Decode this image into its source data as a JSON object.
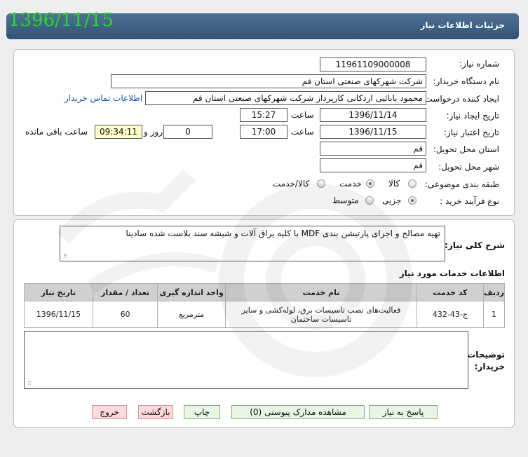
{
  "header": {
    "date_stamp": "1396/11/15",
    "title": "جزئیات اطلاعات نیاز"
  },
  "form": {
    "need_number": {
      "label": "شماره نیاز:",
      "value": "11961109000008"
    },
    "buyer_org": {
      "label": "نام دستگاه خریدار:",
      "value": "شرکت شهرکهای صنعتی استان قم"
    },
    "requester": {
      "label": "ایجاد کننده درخواست:",
      "value": "محمود بابائیی اردکانی کارپرداز شرکت شهرکهای صنعتی استان قم",
      "contact_link": "اطلاعات تماس خریدار"
    },
    "created": {
      "label": "تاریخ ایجاد نیاز:",
      "date": "1396/11/14",
      "time_label": "ساعت",
      "time": "15:27"
    },
    "validity": {
      "label": "تاریخ اعتبار نیاز:",
      "date": "1396/11/15",
      "time_label": "ساعت",
      "time": "17:00",
      "days": "0",
      "days_label": "روز و",
      "remaining_time": "09:34:11",
      "remaining_label": "ساعت باقی مانده"
    },
    "province": {
      "label": "استان محل تحویل:",
      "value": "قم"
    },
    "city": {
      "label": "شهر محل تحویل:",
      "value": "قم"
    },
    "category": {
      "label": "طبقه بندی موضوعی:",
      "options": [
        "کالا",
        "خدمت",
        "کالا/خدمت"
      ],
      "selected": "خدمت"
    },
    "process": {
      "label": "نوع فرآیند خرید :",
      "options": [
        "جزیی",
        "متوسط"
      ],
      "selected": "جزیی"
    }
  },
  "summary": {
    "label": "شرح کلی نیاز:",
    "text": "تهیه مصالح و اجرای پارتیشن بندی MDF با کلیه یراق آلات و شیشه سند بلاست شده سادینا"
  },
  "services": {
    "title": "اطلاعات خدمات مورد نیاز",
    "columns": [
      "ردیف",
      "کد خدمت",
      "نام خدمت",
      "واحد اندازه گیری",
      "تعداد / مقدار",
      "تاریخ نیاز"
    ],
    "rows": [
      [
        "1",
        "ج-43-432",
        "فعالیت‌های نصب تاسیسات برق، لوله‌کشی و سایر تاسیسات ساختمان",
        "مترمربع",
        "60",
        "1396/11/15"
      ]
    ]
  },
  "buyer_notes": {
    "label": "توضیحات خریدار:",
    "value": ""
  },
  "buttons": {
    "reply": "پاسخ به نیاز",
    "attachments": "مشاهده مدارک پیوستی (0)",
    "print": "چاپ",
    "back": "بازگشت",
    "exit": "خروج"
  },
  "colors": {
    "title_bar": "#3b5d80",
    "date_stamp": "#22dd22",
    "button_green": "#e8f6e3",
    "button_pink": "#ffd9dc"
  }
}
